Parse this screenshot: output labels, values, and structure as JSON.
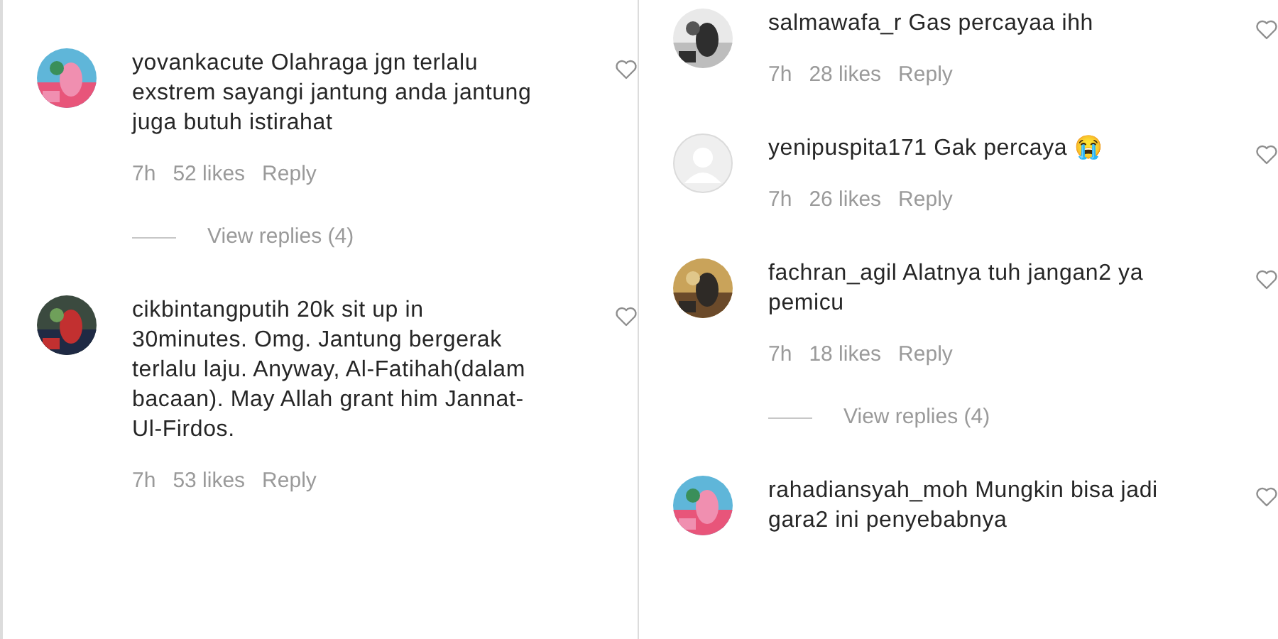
{
  "columns": [
    {
      "comments": [
        {
          "username": "yovankacute",
          "text": "Olahraga jgn terlalu exstrem sayangi jantung anda jantung juga butuh istirahat",
          "time": "7h",
          "likes": "52 likes",
          "reply": "Reply",
          "view_replies": "View replies (4)"
        },
        {
          "username": "cikbintangputih",
          "text": "20k sit up in 30minutes. Omg. Jantung bergerak terlalu laju. Anyway, Al-Fatihah(dalam bacaan). May Allah grant him Jannat-Ul-Firdos.",
          "time": "7h",
          "likes": "53 likes",
          "reply": "Reply"
        }
      ]
    },
    {
      "comments": [
        {
          "username": "salmawafa_r",
          "text": "Gas percayaa ihh",
          "time": "7h",
          "likes": "28 likes",
          "reply": "Reply"
        },
        {
          "avatar": {
            "kind": "default"
          },
          "username": "yenipuspita171",
          "text": "Gak percaya 😭",
          "time": "7h",
          "likes": "26 likes",
          "reply": "Reply"
        },
        {
          "username": "fachran_agil",
          "text": "Alatnya tuh jangan2 ya pemicu",
          "time": "7h",
          "likes": "18 likes",
          "reply": "Reply",
          "view_replies": "View replies (4)"
        },
        {
          "username": "rahadiansyah_moh",
          "text": "Mungkin bisa jadi gara2 ini penyebabnya"
        }
      ]
    }
  ]
}
